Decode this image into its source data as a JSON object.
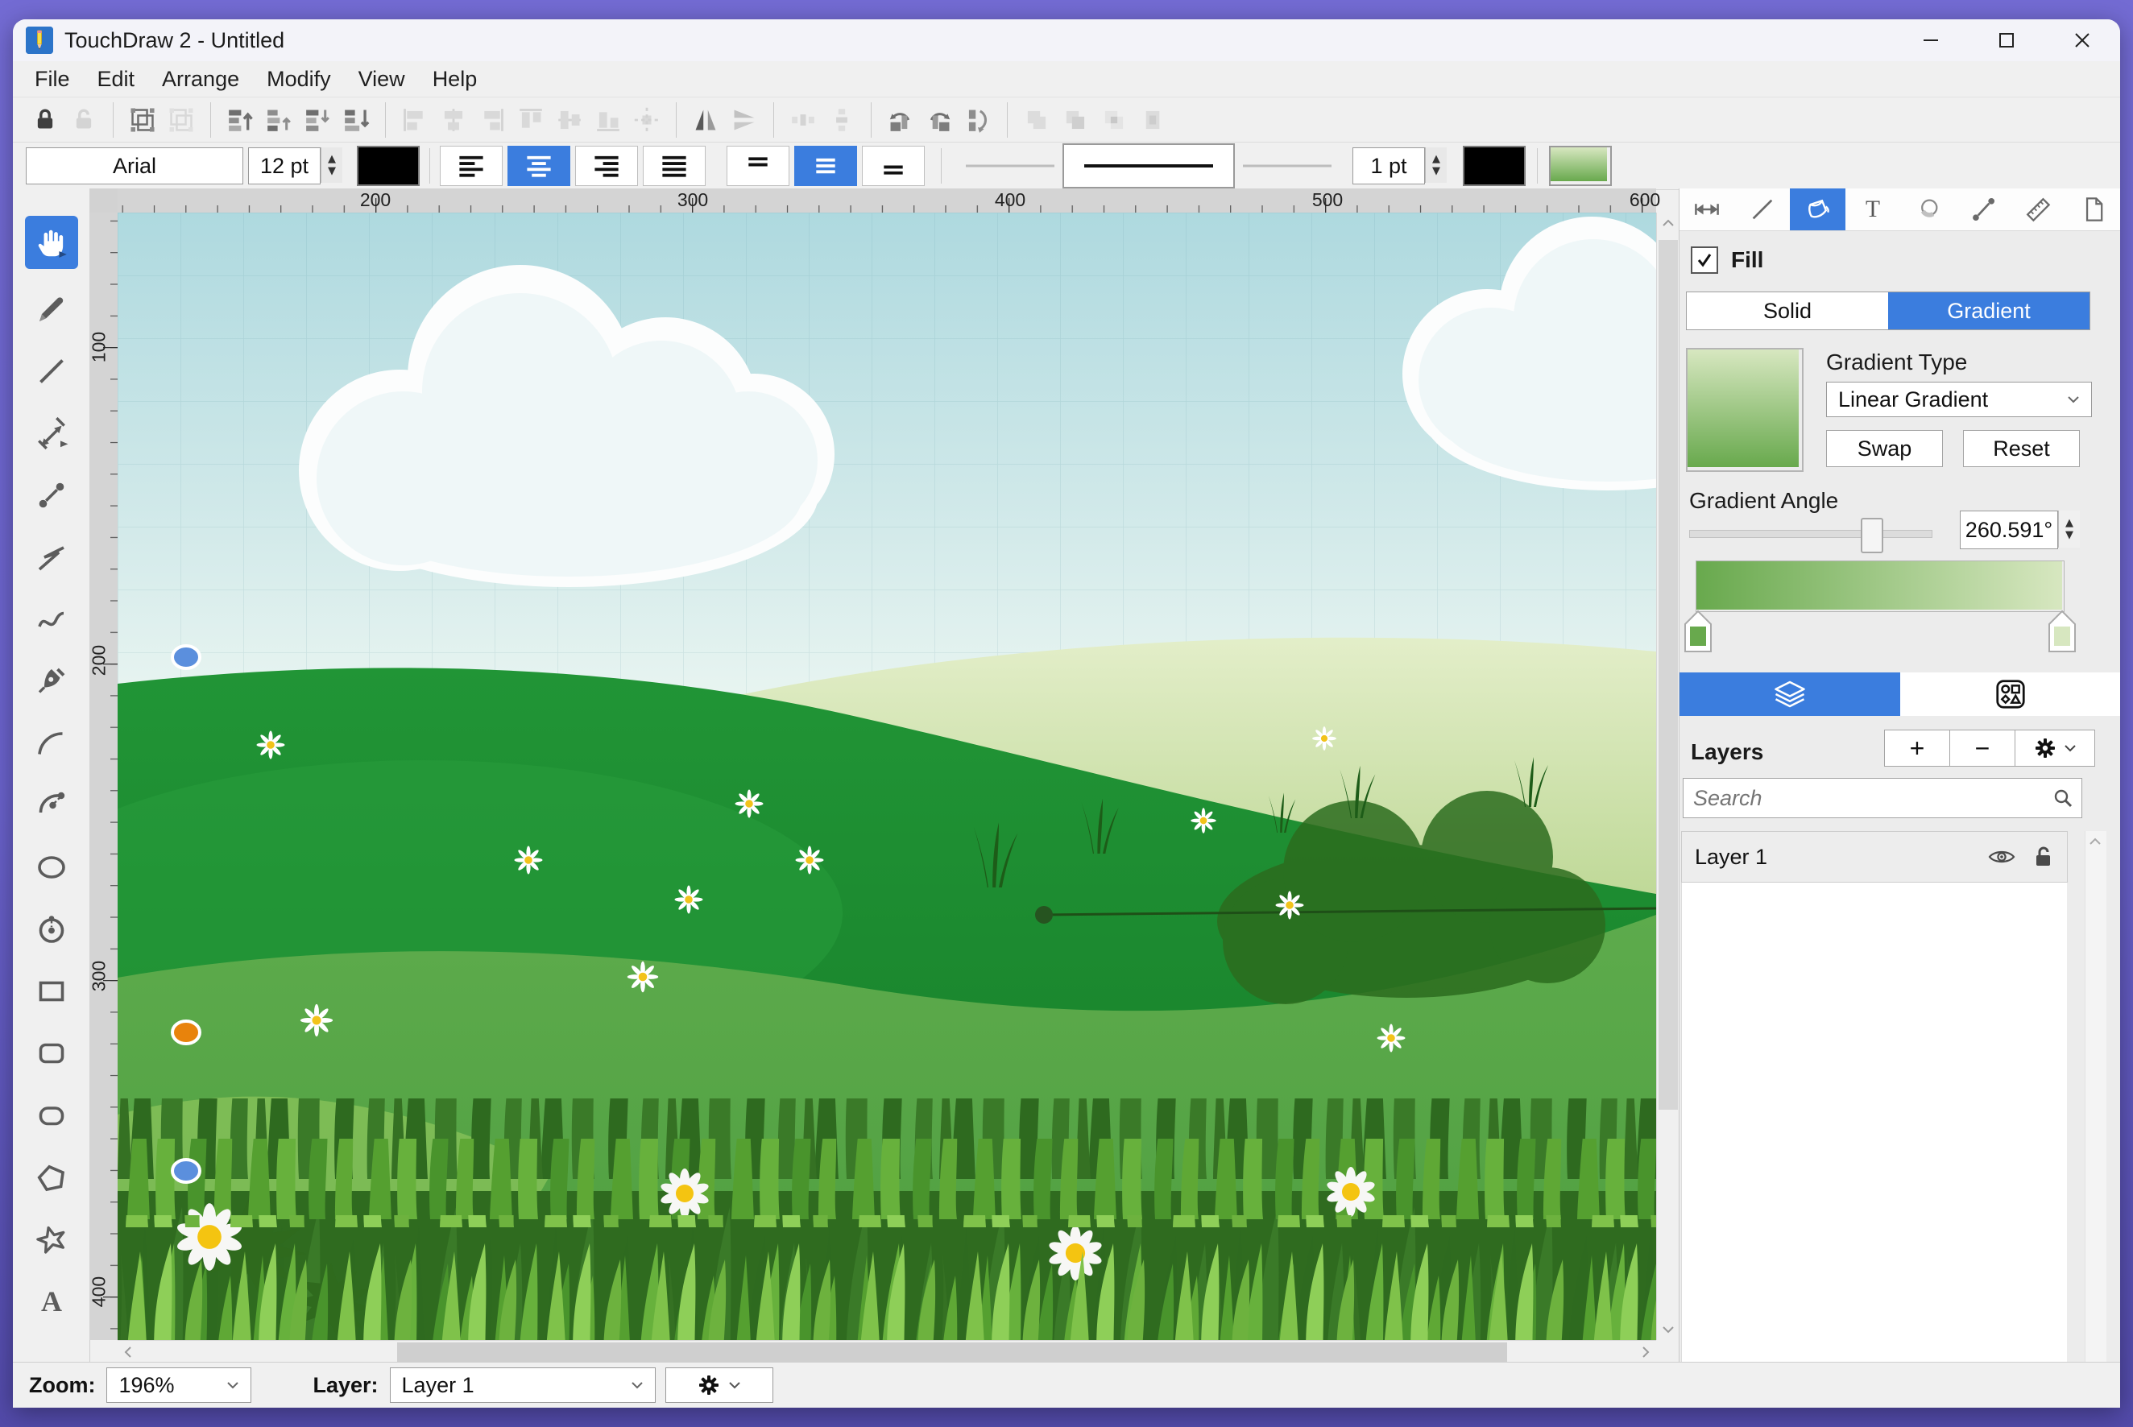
{
  "window": {
    "title": "TouchDraw 2 - Untitled"
  },
  "menubar": {
    "items": [
      "File",
      "Edit",
      "Arrange",
      "Modify",
      "View",
      "Help"
    ]
  },
  "toolbar": {
    "font_family": "Arial",
    "font_size": "12 pt",
    "stroke_width": "1 pt",
    "text_color": "#000000",
    "stroke_color": "#000000"
  },
  "rulers": {
    "top": [
      "200",
      "300",
      "400",
      "500",
      "600"
    ],
    "left": [
      "100",
      "200",
      "300",
      "400"
    ]
  },
  "fill": {
    "label": "Fill",
    "solid": "Solid",
    "gradient": "Gradient",
    "type_label": "Gradient Type",
    "type_value": "Linear Gradient",
    "swap": "Swap",
    "reset": "Reset",
    "angle_label": "Gradient Angle",
    "angle_value": "260.591°",
    "gradient_start": "#68a94d",
    "gradient_end": "#d7e7c0"
  },
  "layers": {
    "title": "Layers",
    "add": "+",
    "remove": "−",
    "search_placeholder": "Search",
    "rows": [
      {
        "name": "Layer 1"
      }
    ]
  },
  "status": {
    "zoom_label": "Zoom:",
    "zoom_value": "196%",
    "layer_label": "Layer:",
    "layer_value": "Layer 1"
  },
  "colors": {
    "accent": "#3b7dde",
    "selection_handle_blue": "#5b8fdd",
    "selection_handle_orange": "#e8830c"
  }
}
